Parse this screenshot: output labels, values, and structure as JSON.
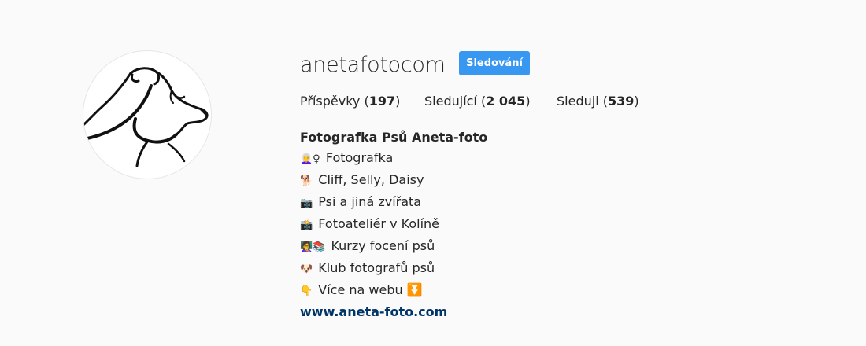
{
  "profile": {
    "username": "anetafotocom",
    "follow_button": "Sledování",
    "stats": {
      "posts_label": "Příspěvky",
      "posts_count": "197",
      "followers_label": "Sledující",
      "followers_count": "2 045",
      "following_label": "Sleduji",
      "following_count": "539"
    },
    "bio": {
      "name": "Fotografka Psů Aneta-foto",
      "lines": [
        {
          "icon": "👩‍🦳♀",
          "text": "Fotografka"
        },
        {
          "icon": "🐕",
          "text": "Cliff, Selly, Daisy"
        },
        {
          "icon": "📷",
          "text": "Psi a jiná zvířata"
        },
        {
          "icon": "📸",
          "text": "Fotoateliér v Kolíně"
        },
        {
          "icon": "👩‍🏫📚",
          "text": "Kurzy focení psů"
        },
        {
          "icon": "🐶",
          "text": "Klub fotografů psů"
        },
        {
          "icon": "👇",
          "text": "Více na webu ⏬"
        }
      ],
      "link": "www.aneta-foto.com"
    }
  },
  "colors": {
    "background": "#fafafa",
    "button": "#3897f0",
    "link": "#003569",
    "text": "#262626"
  }
}
